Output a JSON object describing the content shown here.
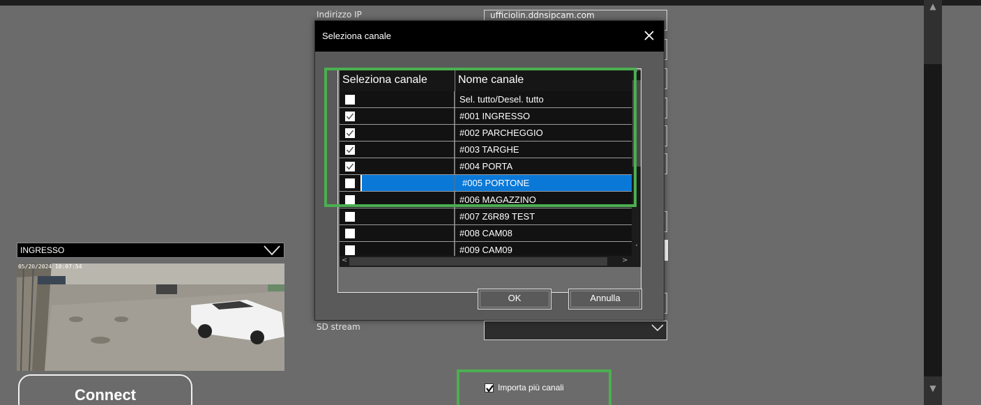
{
  "form": {
    "ip_label": "Indirizzo IP",
    "ip_value": "ufficiolin.ddnsipcam.com",
    "sd_stream_label": "SD stream"
  },
  "camera": {
    "selected": "INGRESSO",
    "timestamp_overlay": "05/20/2024 10:07:54"
  },
  "connect_label": "Connect",
  "import_multi": {
    "label": "Importa più canali",
    "checked": true
  },
  "dialog": {
    "title": "Seleziona canale",
    "col_select": "Seleziona canale",
    "col_name": "Nome canale",
    "rows": [
      {
        "name": "Sel. tutto/Desel. tutto",
        "checked": false,
        "selected": false
      },
      {
        "name": "#001 INGRESSO",
        "checked": true,
        "selected": false
      },
      {
        "name": "#002 PARCHEGGIO",
        "checked": true,
        "selected": false
      },
      {
        "name": "#003 TARGHE",
        "checked": true,
        "selected": false
      },
      {
        "name": "#004 PORTA",
        "checked": true,
        "selected": false
      },
      {
        "name": "#005 PORTONE",
        "checked": false,
        "selected": true
      },
      {
        "name": "#006 MAGAZZINO",
        "checked": false,
        "selected": false
      },
      {
        "name": "#007 Z6R89 TEST",
        "checked": false,
        "selected": false
      },
      {
        "name": "#008 CAM08",
        "checked": false,
        "selected": false
      },
      {
        "name": "#009 CAM09",
        "checked": false,
        "selected": false
      }
    ],
    "ok_label": "OK",
    "cancel_label": "Annulla"
  },
  "colors": {
    "background": "#6b6b6b",
    "highlight_green": "#4caf50",
    "selection_blue": "#0a78d7",
    "title_bar": "#000000"
  },
  "icons": [
    "close-icon",
    "chevron-down-icon",
    "checkmark-icon",
    "scroll-up-icon",
    "scroll-down-icon",
    "scroll-left-icon",
    "scroll-right-icon"
  ]
}
